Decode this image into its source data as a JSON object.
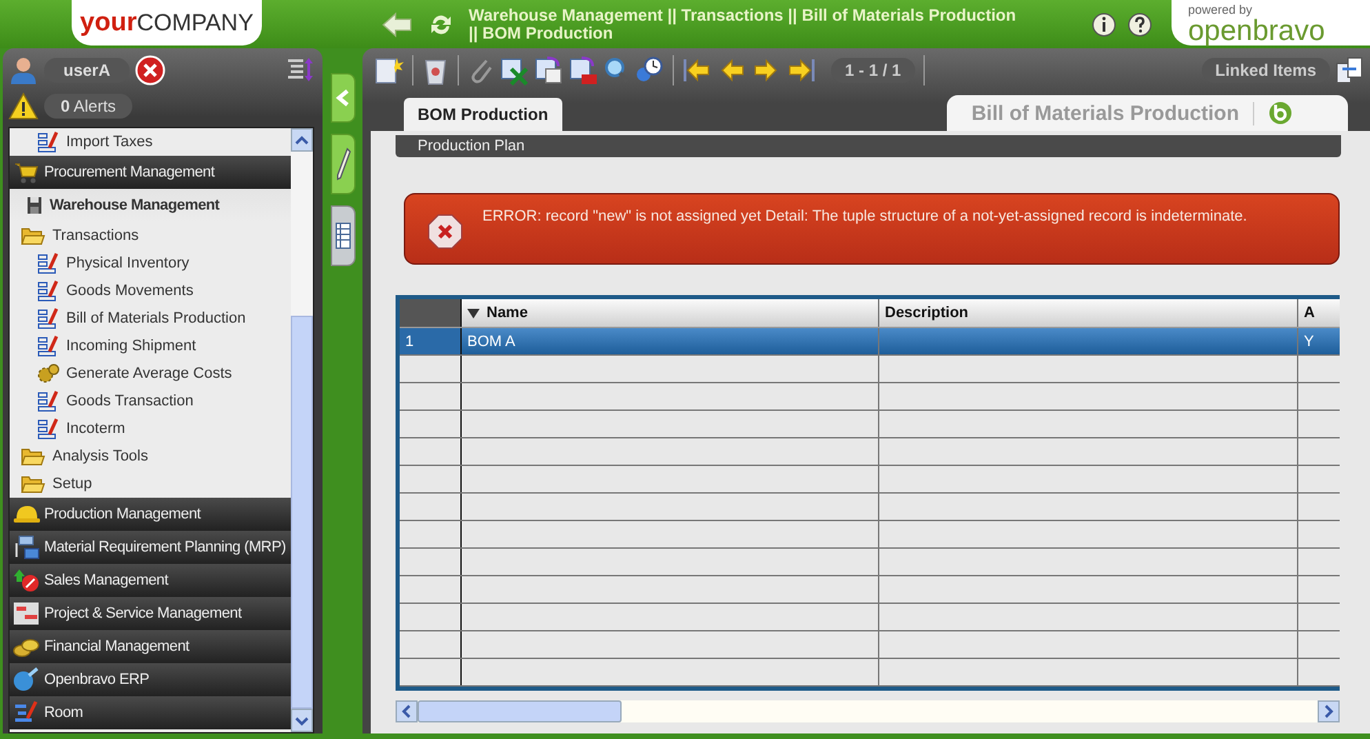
{
  "header": {
    "logo": {
      "bold": "your",
      "rest": "COMPANY"
    },
    "breadcrumb": [
      "Warehouse Management || Transactions || Bill of Materials Production",
      "||  BOM Production"
    ],
    "powered_by": "powered by",
    "brand": "openbravo"
  },
  "user": {
    "name": "userA",
    "alerts_count": "0",
    "alerts_label": "Alerts"
  },
  "menu": {
    "items": [
      {
        "kind": "window",
        "label": "Import Taxes"
      },
      {
        "kind": "module",
        "label": "Procurement Management",
        "expanded": false
      },
      {
        "kind": "module",
        "label": "Warehouse Management",
        "expanded": true,
        "children": [
          {
            "kind": "folder",
            "label": "Transactions",
            "children": [
              {
                "kind": "window",
                "label": "Physical Inventory"
              },
              {
                "kind": "window",
                "label": "Goods Movements"
              },
              {
                "kind": "window",
                "label": "Bill of Materials Production"
              },
              {
                "kind": "window",
                "label": "Incoming Shipment"
              },
              {
                "kind": "process",
                "label": "Generate Average Costs"
              },
              {
                "kind": "window",
                "label": "Goods Transaction"
              },
              {
                "kind": "window",
                "label": "Incoterm"
              }
            ]
          },
          {
            "kind": "folder",
            "label": "Analysis Tools"
          },
          {
            "kind": "folder",
            "label": "Setup"
          }
        ]
      },
      {
        "kind": "module",
        "label": "Production Management",
        "expanded": false
      },
      {
        "kind": "module",
        "label": "Material Requirement Planning (MRP)",
        "expanded": false
      },
      {
        "kind": "module",
        "label": "Sales Management",
        "expanded": false
      },
      {
        "kind": "module",
        "label": "Project & Service Management",
        "expanded": false
      },
      {
        "kind": "module",
        "label": "Financial Management",
        "expanded": false
      },
      {
        "kind": "module",
        "label": "Openbravo ERP",
        "expanded": false
      },
      {
        "kind": "module",
        "label": "Room",
        "expanded": false
      }
    ]
  },
  "toolbar": {
    "record_counter": "1 - 1 / 1",
    "linked_items": "Linked Items"
  },
  "tabs": [
    {
      "label": "BOM Production",
      "selected": true
    }
  ],
  "window_title": "Bill of Materials Production",
  "subtabs": [
    "Production Plan"
  ],
  "error": {
    "message": "ERROR: record \"new\" is not assigned yet Detail: The tuple structure of a not-yet-assigned record is indeterminate."
  },
  "grid": {
    "columns": [
      {
        "label": "Name",
        "sorted": true
      },
      {
        "label": "Description",
        "sorted": false
      },
      {
        "label": "A",
        "sorted": false
      }
    ],
    "rows": [
      {
        "number": "1",
        "cells": [
          "BOM A",
          "",
          "Y"
        ],
        "selected": true
      }
    ]
  }
}
